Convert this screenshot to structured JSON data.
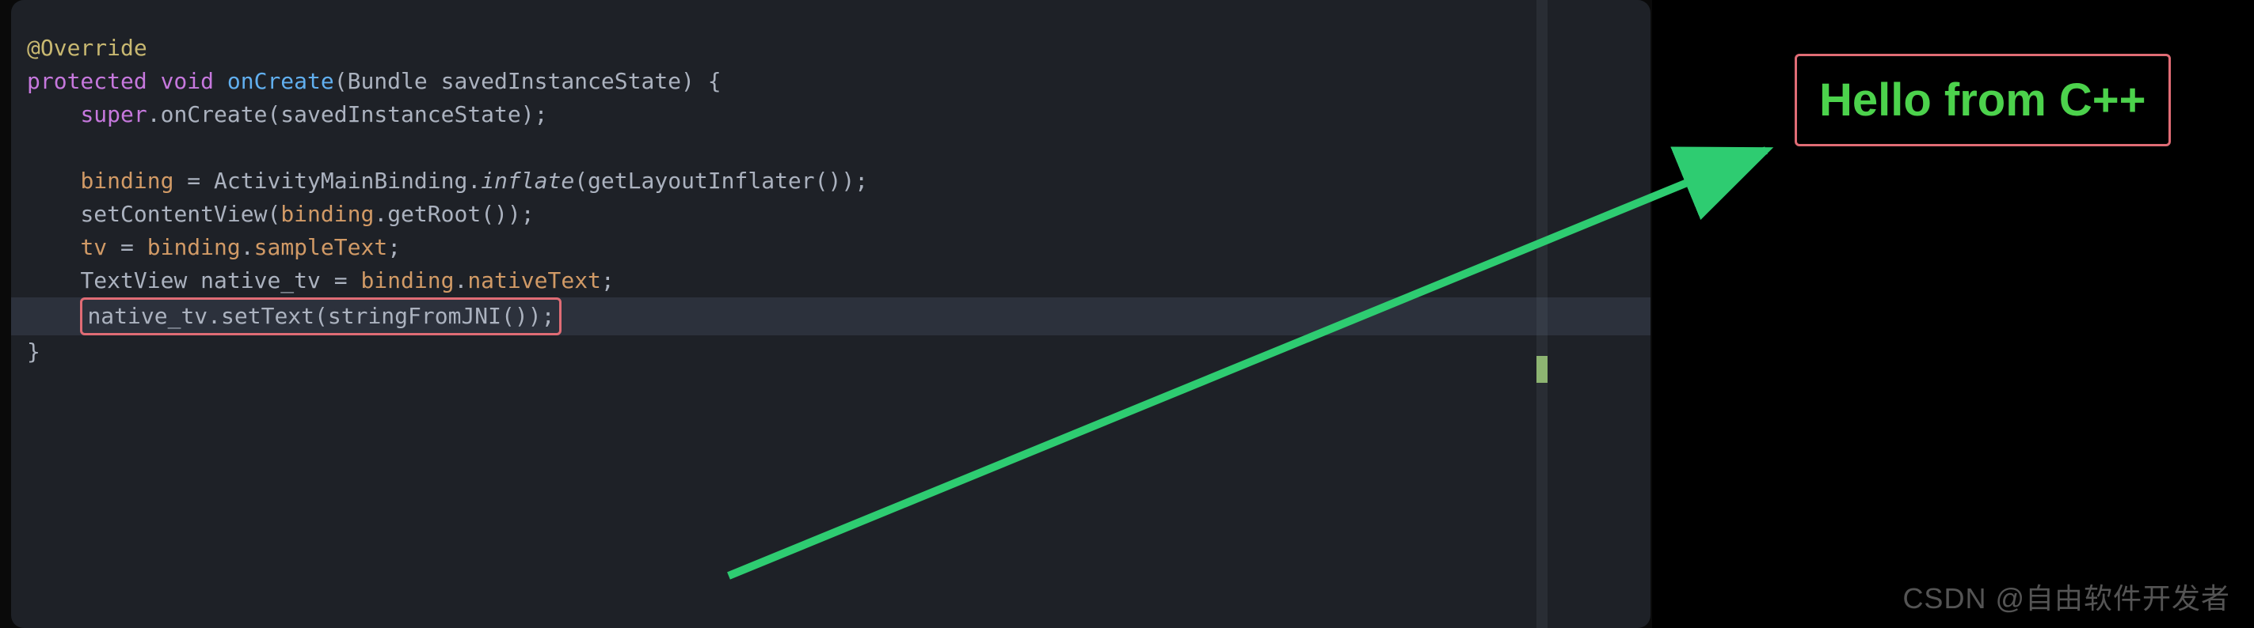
{
  "code": {
    "line1_annotation": "@Override",
    "line2": {
      "modifier": "protected",
      "retType": "void",
      "methodName": "onCreate",
      "paramType": "Bundle",
      "paramName": "savedInstanceState",
      "brace": " {"
    },
    "line3": {
      "indent": "    ",
      "superKw": "super",
      "dot": ".",
      "call": "onCreate",
      "args": "(savedInstanceState);"
    },
    "line4_blank": "",
    "line5": {
      "indent": "    ",
      "field": "binding",
      "eq": " = ",
      "cls": "ActivityMainBinding",
      "dot": ".",
      "method": "inflate",
      "args": "(getLayoutInflater());"
    },
    "line6": {
      "indent": "    ",
      "call": "setContentView",
      "open": "(",
      "field": "binding",
      "dot": ".",
      "method": "getRoot",
      "close": "());"
    },
    "line7": {
      "indent": "    ",
      "field1": "tv",
      "eq": " = ",
      "field2": "binding",
      "dot": ".",
      "prop": "sampleText",
      "semi": ";"
    },
    "line8": {
      "indent": "    ",
      "type": "TextView",
      "space": " ",
      "var": "native_tv",
      "eq": " = ",
      "field": "binding",
      "dot": ".",
      "prop": "nativeText",
      "semi": ";"
    },
    "line9": {
      "indent": "    ",
      "boxed": "native_tv.setText(stringFromJNI());"
    },
    "line10_brace": "}"
  },
  "output": {
    "hello": "Hello from C++"
  },
  "watermark": "CSDN @自由软件开发者"
}
